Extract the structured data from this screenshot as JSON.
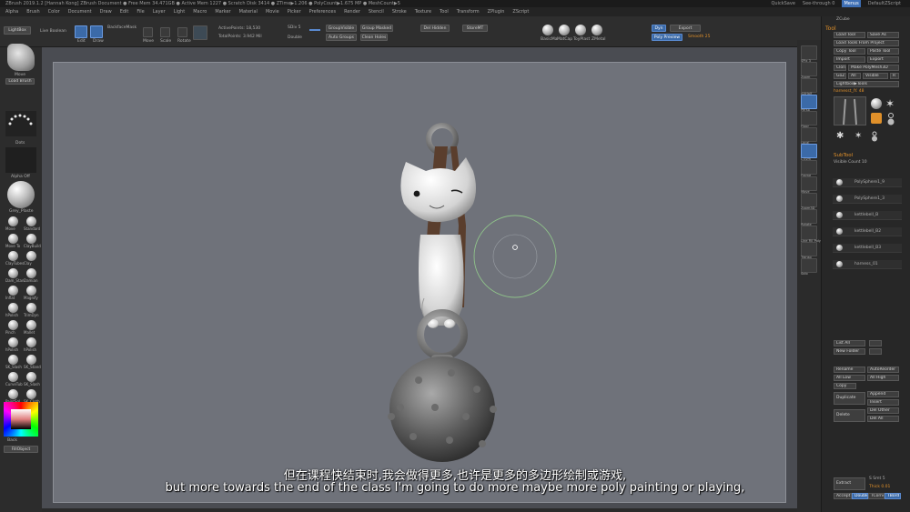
{
  "titlebar": {
    "text": "ZBrush 2019.1.2 [Hannah Kong]   ZBrush Document   ● Free Mem 34.471GB ● Active Mem 1227 ● Scratch Disk 3414 ● ZTime▶1.206 ● PolyCount▶1.675 MP ● MeshCount▶5",
    "quicksave": "QuickSave",
    "seethrough": "See-through 0",
    "menus": "Menus",
    "defaultscript": "DefaultZScript"
  },
  "menubar": [
    "Alpha",
    "Brush",
    "Color",
    "Document",
    "Draw",
    "Edit",
    "File",
    "Layer",
    "Light",
    "Macro",
    "Marker",
    "Material",
    "Movie",
    "Picker",
    "Preferences",
    "Render",
    "Stencil",
    "Stroke",
    "Texture",
    "Tool",
    "Transform",
    "ZPlugin",
    "ZScript"
  ],
  "shelf": {
    "lightbox": "LightBox",
    "live_boolean": "Live Boolean",
    "edit": "Edit",
    "draw": "Draw",
    "move": "Move",
    "scale": "Scale",
    "rotate": "Rotate",
    "backface_mask": "BackfaceMask",
    "active_points": "ActivePoints: 18,530",
    "total_points": "TotalPoints: 3.942 Mil",
    "sdiv": "SDiv 5",
    "double": "Double",
    "group_visible": "GroupVisible",
    "auto_groups": "Auto Groups",
    "group_masked": "Group Masked",
    "clean_holes": "Clean Holes",
    "del_hidden": "Del Hidden",
    "store_mt": "StoreMT",
    "mat_labels": [
      "BasicMa",
      "MatCap",
      "ToyPlast",
      "ZMetal"
    ],
    "dyn_on": "Dyn",
    "export": "Export",
    "poly_frame": "PolyF",
    "smooth": "Smooth 25",
    "poly_preview": "Poly Preview"
  },
  "leftpanel": {
    "move_label": "Move",
    "load_brush": "Load Brush",
    "dots_label": "Dots",
    "alpha_off": "Alpha Off",
    "basic_label": "Grey_Plaste",
    "brushes": [
      "Move",
      "Standard",
      "Move To",
      "ClayBuild",
      "ClayTubes",
      "Clay",
      "Dam_Stan",
      "Damian",
      "Inflat",
      "Magnify",
      "hPolish",
      "TrimDyn",
      "Pinch",
      "Mallet",
      "hPolish",
      "hPolish",
      "SK_Slash",
      "SK_Stand",
      "CurveTub",
      "SK_Slash",
      "PaintSgl",
      "SK_Cloth"
    ],
    "back_label": "Back",
    "fill_object": "FillObject"
  },
  "rightpanel": {
    "header": "ZCube",
    "tool_title": "Tool",
    "load_tool": "Load Tool",
    "save_as": "Save As",
    "load_from_project": "Load Tools From Project",
    "copy_tool": "Copy Tool",
    "paste_tool": "Paste Tool",
    "import": "Import",
    "export": "Export",
    "clone": "Clone",
    "make_polymesh": "Make PolyMesh3D",
    "goz": "GoZ",
    "all": "All",
    "visible": "Visible",
    "r": "R",
    "lightbox_tools": "Lightbox▶Tools",
    "hammer_count": "harnesst_IY. 48",
    "subtool": "SubTool",
    "visible_count": "Visible Count 10",
    "subtools": [
      "PolySphere1_9",
      "PolySphere1_3",
      "kettlebell_B",
      "kettlebell_B2",
      "kettlebell_B3",
      "harness_01"
    ],
    "list_all": "List All",
    "new_folder": "New Folder",
    "rename": "Rename",
    "auto_reorder": "AutoReorder",
    "all_low": "All Low",
    "all_high": "All High",
    "copy": "Copy",
    "duplicate": "Duplicate",
    "append": "Append",
    "insert": "Insert",
    "delete": "Delete",
    "del_other": "Del Other",
    "del_all": "Del All",
    "extract": "Extract",
    "s_smt": "S Smt 5",
    "thick": "Thick 0.01",
    "accept": "Accept",
    "double": "Double",
    "tcorne": "TCorne",
    "tbord": "TBord"
  },
  "rightstrip": [
    "SPix 3",
    "Zoom",
    "AAHalf",
    "Persp",
    "Floor",
    "Local",
    "L.Sym",
    "Frame",
    "Move",
    "Zoom3D",
    "Rotate",
    "Line Fill PolyF",
    "Transp",
    "Solo"
  ],
  "subtitles": {
    "cn": "但在课程快结束时,我会做得更多,也许是更多的多边形绘制或游戏,",
    "en": "but more towards the end of the class I'm going to do more maybe more poly painting or playing,"
  },
  "colors": {
    "accent_blue": "#3b6aa8",
    "canvas_bg": "#6f727a",
    "orange": "#e0902a"
  }
}
